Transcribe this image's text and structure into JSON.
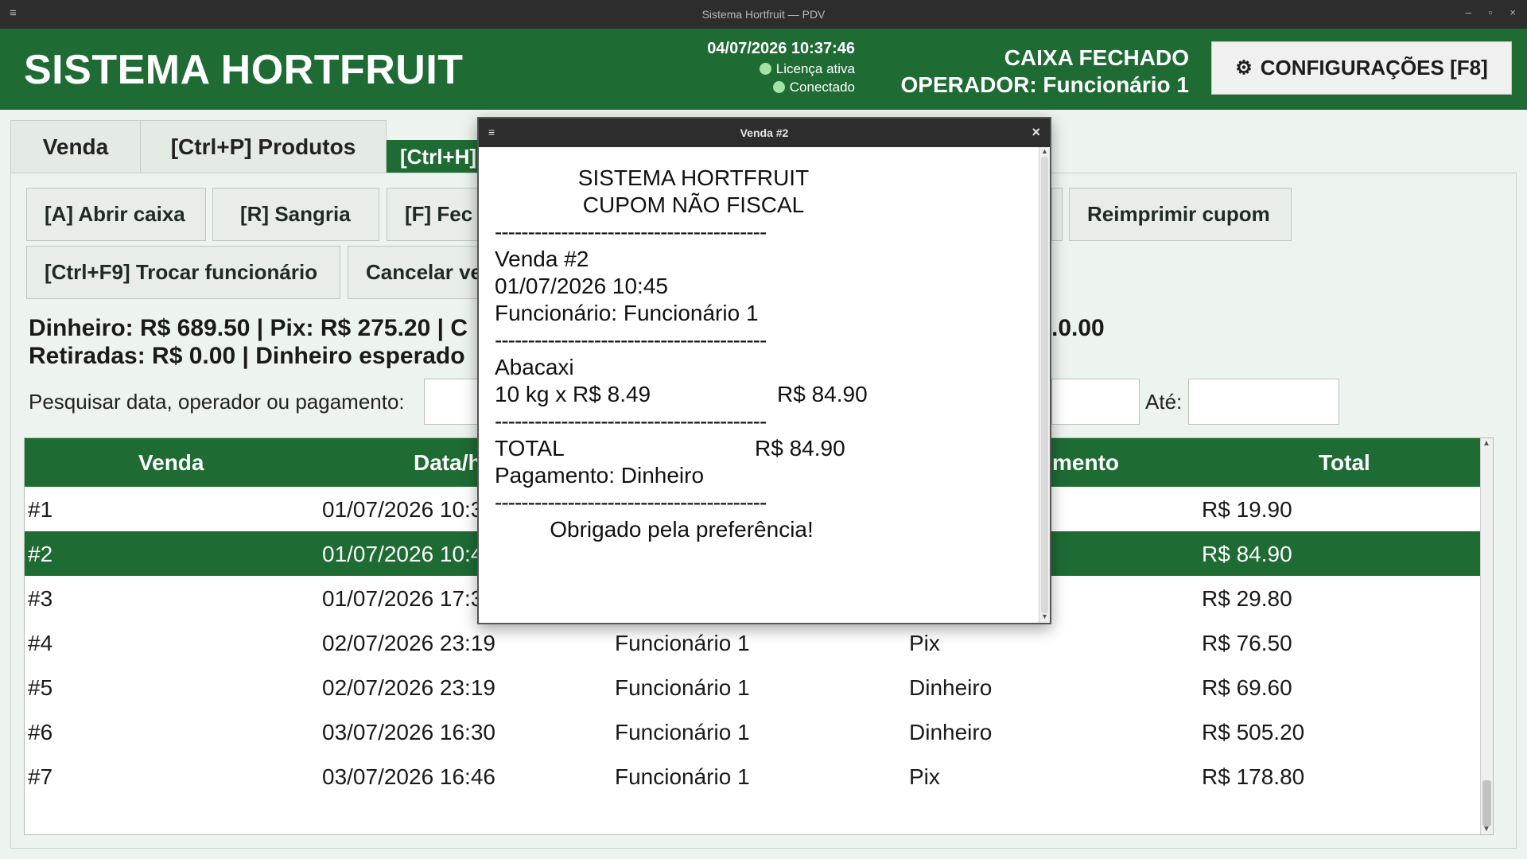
{
  "window": {
    "title": "Sistema Hortfruit — PDV",
    "menu_glyph": "≡",
    "min_glyph": "–",
    "max_glyph": "▫",
    "close_glyph": "×"
  },
  "header": {
    "brand": "SISTEMA HORTFRUIT",
    "datetime": "04/07/2026 10:37:46",
    "license": "Licença ativa",
    "connection": "Conectado",
    "caixa_status": "CAIXA FECHADO",
    "operator": "OPERADOR: Funcionário 1",
    "config_label": "CONFIGURAÇÕES  [F8]",
    "status_color": "#a4e3a8",
    "brand_color": "#1e6b34"
  },
  "tabs": [
    {
      "label": "Venda"
    },
    {
      "label": "[Ctrl+P] Produtos"
    },
    {
      "label": "[Ctrl+H]"
    }
  ],
  "actions": {
    "abrir_caixa": "[A] Abrir caixa",
    "sangria": "[R] Sangria",
    "fechar_partial": "[F] Fec",
    "reimprimir": "Reimprimir cupom",
    "trocar_funcionario": "[Ctrl+F9] Trocar funcionário",
    "cancelar_partial": "Cancelar ve"
  },
  "summary": {
    "line1": "Dinheiro: R$ 689.50 | Pix: R$ 275.20 | C",
    "line1_tail": ".0.00",
    "line2": "Retiradas: R$ 0.00 | Dinheiro esperado"
  },
  "search": {
    "label": "Pesquisar data, operador ou pagamento:",
    "ate_label": "Até:"
  },
  "table": {
    "headers": {
      "venda": "Venda",
      "data": "Data/h",
      "pagamento": "mento",
      "total": "Total"
    },
    "rows": [
      {
        "venda": "#1",
        "data": "01/07/2026 10:3",
        "operador": "",
        "pagamento": "",
        "total": "R$ 19.90"
      },
      {
        "venda": "#2",
        "data": "01/07/2026 10:4",
        "operador": "",
        "pagamento": "",
        "total": "R$ 84.90"
      },
      {
        "venda": "#3",
        "data": "01/07/2026 17:3",
        "operador": "",
        "pagamento": "",
        "total": "R$ 29.80"
      },
      {
        "venda": "#4",
        "data": "02/07/2026 23:19",
        "operador": "Funcionário 1",
        "pagamento": "Pix",
        "total": "R$ 76.50"
      },
      {
        "venda": "#5",
        "data": "02/07/2026 23:19",
        "operador": "Funcionário 1",
        "pagamento": "Dinheiro",
        "total": "R$ 69.60"
      },
      {
        "venda": "#6",
        "data": "03/07/2026 16:30",
        "operador": "Funcionário 1",
        "pagamento": "Dinheiro",
        "total": "R$ 505.20"
      },
      {
        "venda": "#7",
        "data": "03/07/2026 16:46",
        "operador": "Funcionário 1",
        "pagamento": "Pix",
        "total": "R$ 178.80"
      }
    ],
    "selected_row": "#2"
  },
  "receipt_modal": {
    "title": "Venda #2",
    "line_title1": "SISTEMA HORTFRUIT",
    "line_title2": "CUPOM NÃO FISCAL",
    "separator": "-----------------------------------------",
    "sale": "Venda #2",
    "datetime": "01/07/2026 10:45",
    "employee": "Funcionário: Funcionário 1",
    "item_name": "Abacaxi",
    "item_qty": "10 kg x R$ 8.49",
    "item_total": "R$ 84.90",
    "total_label": "TOTAL",
    "total_value": "R$ 84.90",
    "payment": "Pagamento: Dinheiro",
    "thanks": "Obrigado pela preferência!"
  }
}
